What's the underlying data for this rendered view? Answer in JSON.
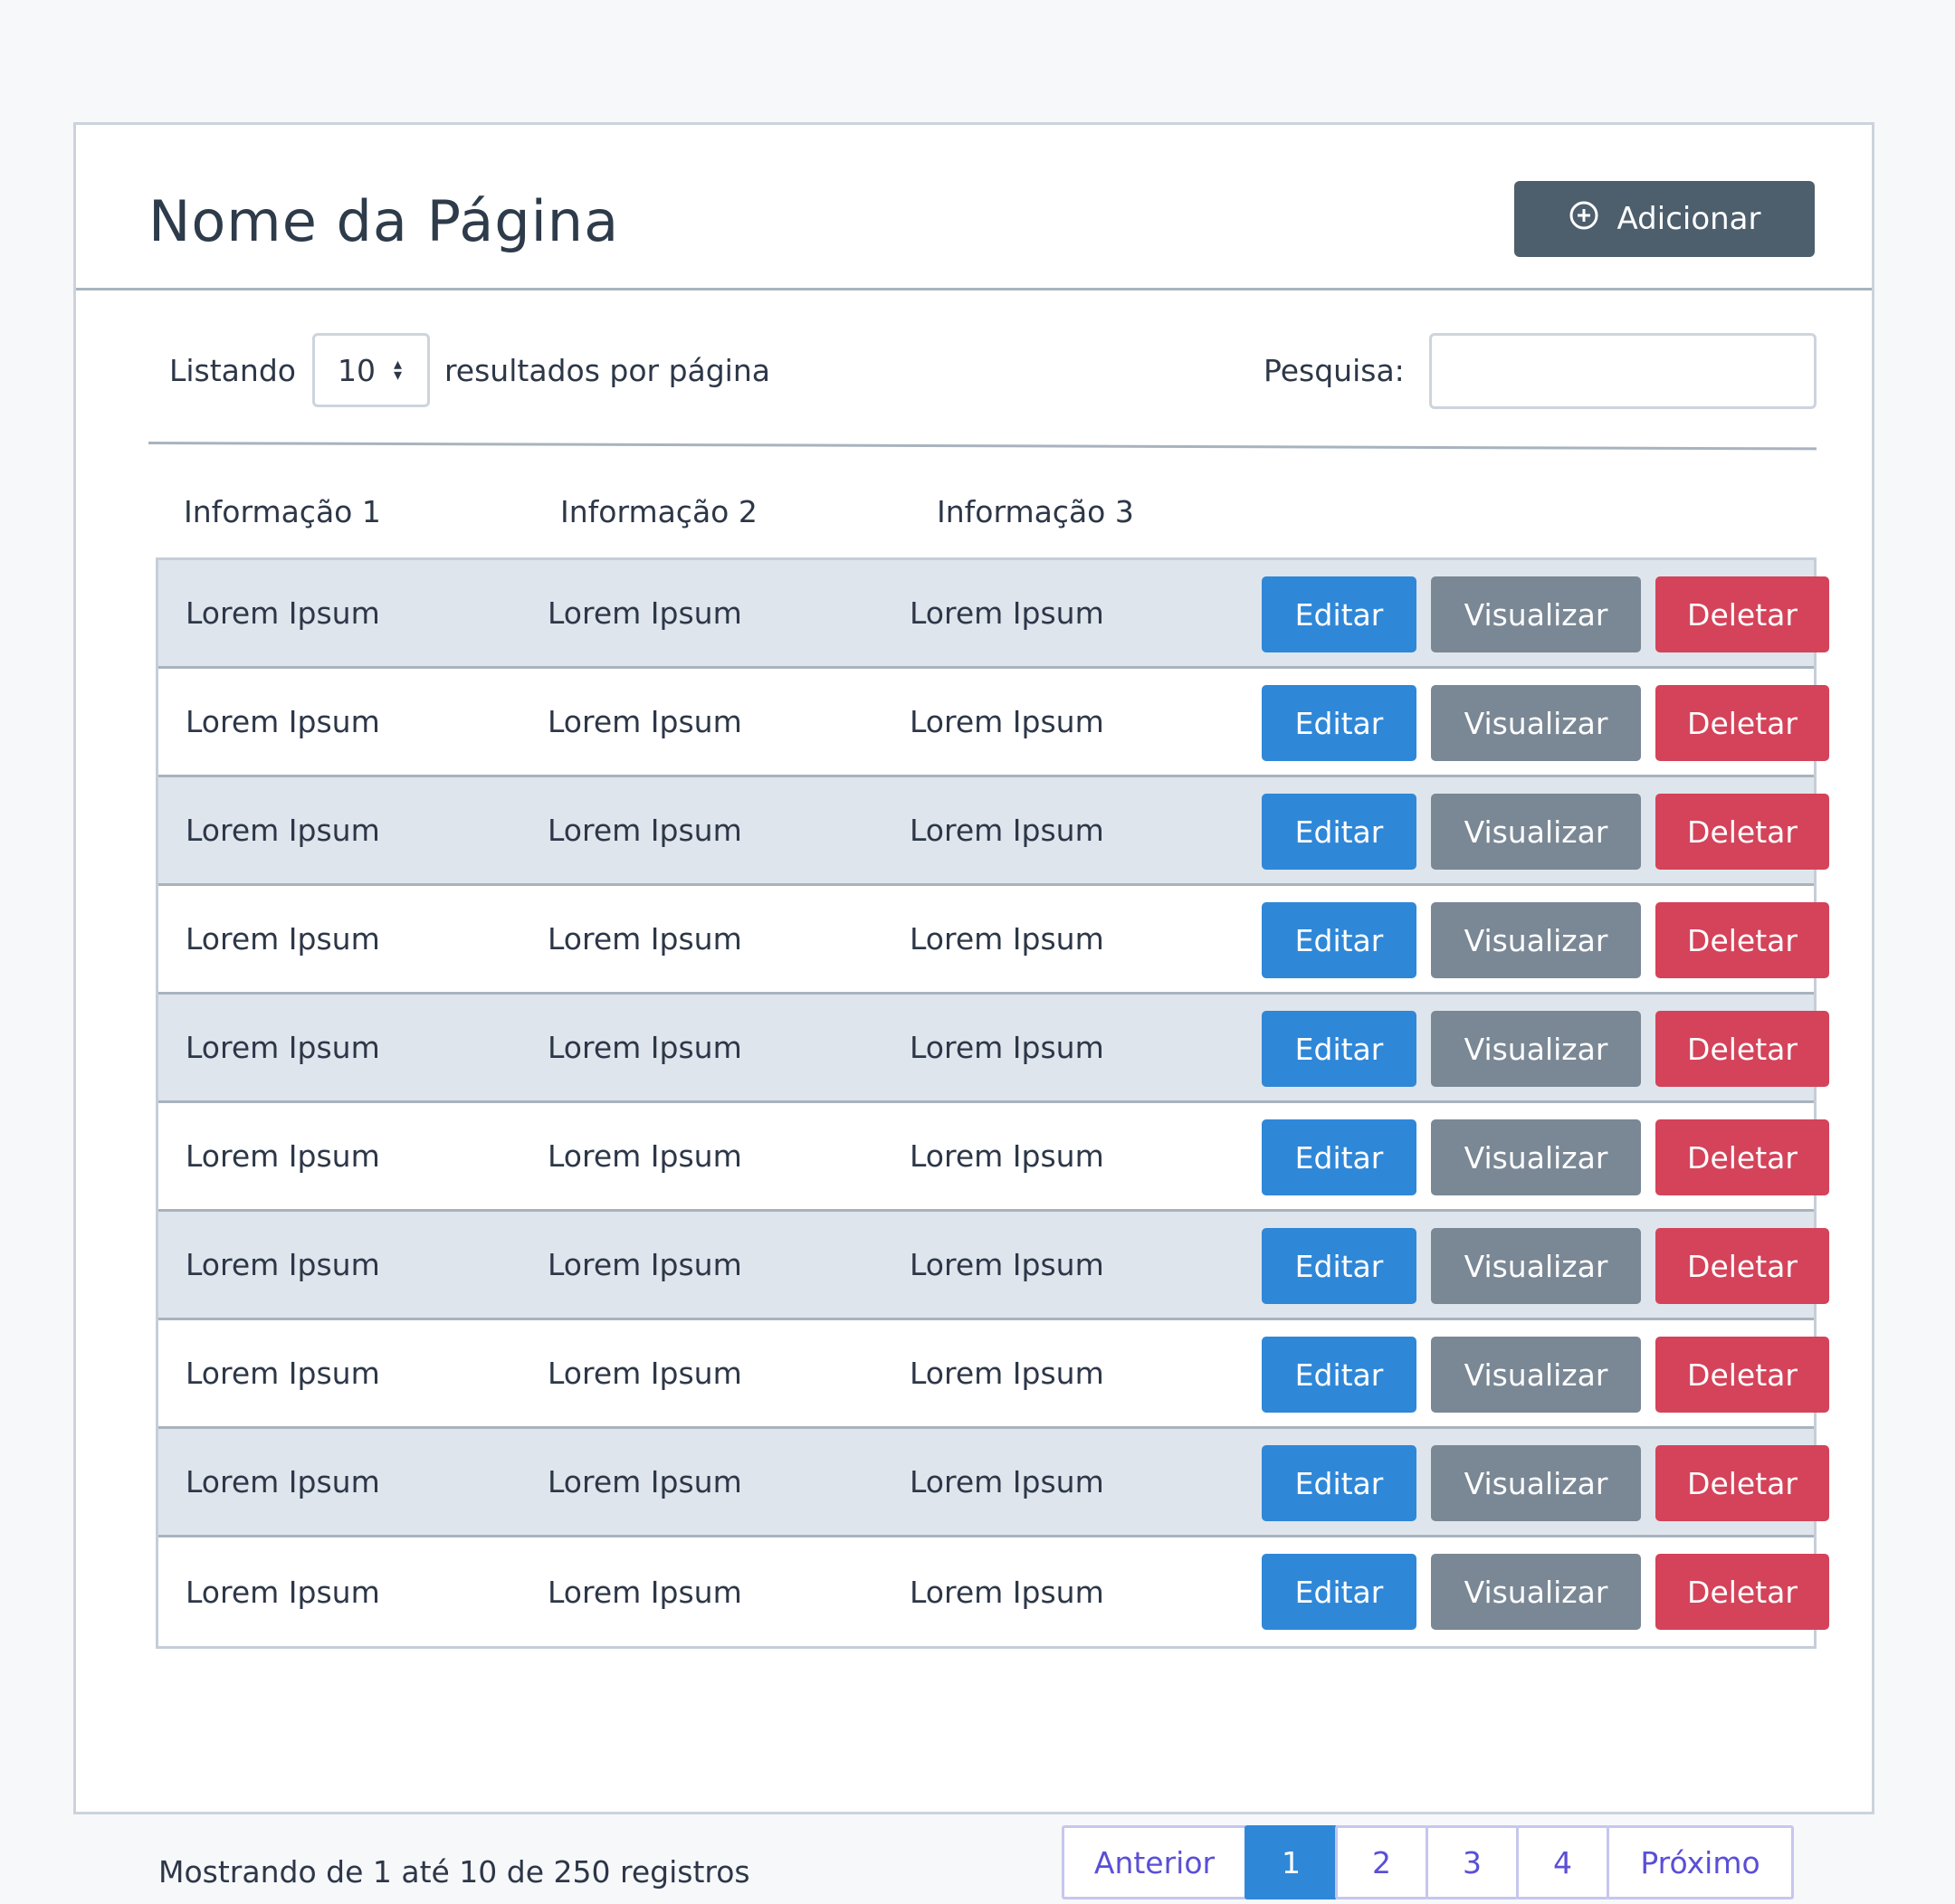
{
  "header": {
    "title": "Nome da Página",
    "add_label": "Adicionar",
    "add_icon": "plus-circle-icon"
  },
  "controls": {
    "listing_label": "Listando",
    "page_size": "10",
    "per_page_label": "resultados por página",
    "search_label": "Pesquisa:",
    "search_value": ""
  },
  "table": {
    "columns": [
      "Informação 1",
      "Informação 2",
      "Informação 3"
    ],
    "rows": [
      [
        "Lorem Ipsum",
        "Lorem Ipsum",
        "Lorem Ipsum"
      ],
      [
        "Lorem Ipsum",
        "Lorem Ipsum",
        "Lorem Ipsum"
      ],
      [
        "Lorem Ipsum",
        "Lorem Ipsum",
        "Lorem Ipsum"
      ],
      [
        "Lorem Ipsum",
        "Lorem Ipsum",
        "Lorem Ipsum"
      ],
      [
        "Lorem Ipsum",
        "Lorem Ipsum",
        "Lorem Ipsum"
      ],
      [
        "Lorem Ipsum",
        "Lorem Ipsum",
        "Lorem Ipsum"
      ],
      [
        "Lorem Ipsum",
        "Lorem Ipsum",
        "Lorem Ipsum"
      ],
      [
        "Lorem Ipsum",
        "Lorem Ipsum",
        "Lorem Ipsum"
      ],
      [
        "Lorem Ipsum",
        "Lorem Ipsum",
        "Lorem Ipsum"
      ],
      [
        "Lorem Ipsum",
        "Lorem Ipsum",
        "Lorem Ipsum"
      ]
    ],
    "actions": {
      "edit": "Editar",
      "view": "Visualizar",
      "delete": "Deletar"
    }
  },
  "footer": {
    "info": "Mostrando de 1 até 10 de 250 registros"
  },
  "pagination": {
    "previous": "Anterior",
    "pages": [
      "1",
      "2",
      "3",
      "4"
    ],
    "active_page": "1",
    "next": "Próximo"
  },
  "colors": {
    "edit": "#2f87d8",
    "view": "#7a8795",
    "delete": "#d4435a",
    "add": "#4d5e6d",
    "pagination_text": "#5a4fd6"
  }
}
